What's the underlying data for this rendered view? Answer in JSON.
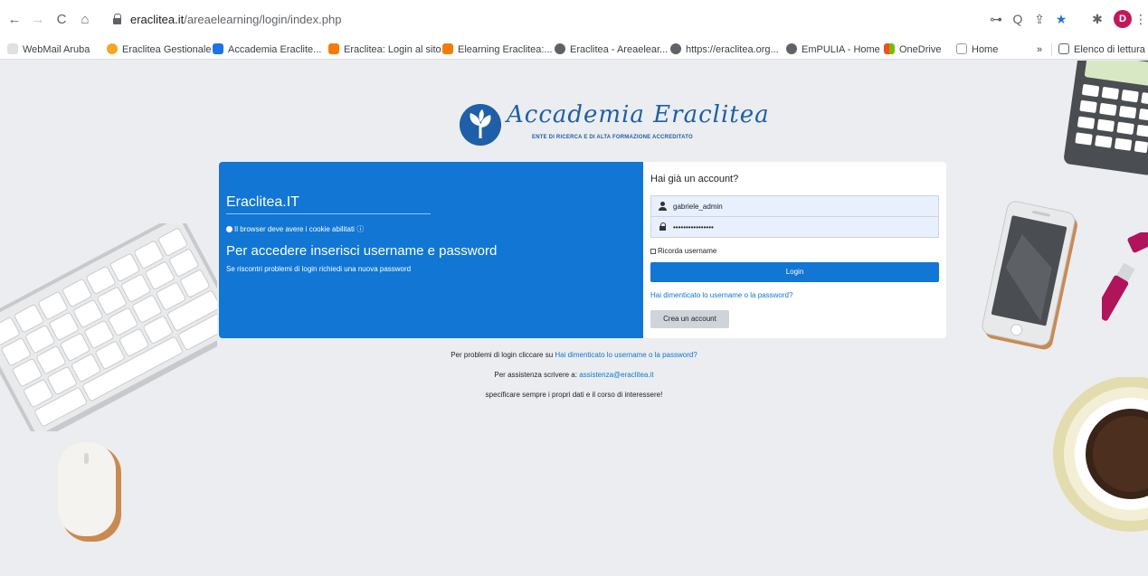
{
  "browser": {
    "url_domain": "eraclitea.it",
    "url_path": "/areaelearning/login/index.php",
    "profile_initial": "D",
    "nav": {
      "back": "←",
      "forward": "→",
      "reload": "C",
      "home": "⌂"
    },
    "toolbar_icons": {
      "key": "⊶",
      "zoom": "Q",
      "share": "⇪",
      "star": "★",
      "extensions": "✱",
      "menu": "⋮"
    }
  },
  "bookmarks": [
    {
      "label": "WebMail Aruba",
      "color": "#e8e8e8"
    },
    {
      "label": "Eraclitea Gestionale",
      "color": "#f6a623"
    },
    {
      "label": "Accademia Eraclite...",
      "color": "#1a73e8"
    },
    {
      "label": "Eraclitea: Login al sito",
      "color": "#f57c00"
    },
    {
      "label": "Elearning Eraclitea:...",
      "color": "#f57c00"
    },
    {
      "label": "Eraclitea - Areaelear...",
      "color": "#5f6368"
    },
    {
      "label": "https://eraclitea.org...",
      "color": "#5f6368"
    },
    {
      "label": "EmPULIA - Home",
      "color": "#5f6368"
    },
    {
      "label": "OneDrive",
      "color": "#f25022"
    },
    {
      "label": "Home",
      "color": "#ffffff"
    }
  ],
  "bookmarks_more": "»",
  "reading_list": "Elenco di lettura",
  "logo": {
    "title": "Accademia Eraclitea",
    "subtitle": "ENTE DI RICERCA E DI ALTA FORMAZIONE ACCREDITATO"
  },
  "left_panel": {
    "site_name": "Eraclitea.IT",
    "cookie_notice": "Il browser deve avere i cookie abilitati",
    "heading": "Per accedere inserisci username e password",
    "help": "Se riscontri problemi di login richiedi una nuova password"
  },
  "login_form": {
    "title": "Hai già un account?",
    "username_value": "gabriele_admin",
    "password_value": "••••••••••••••••",
    "remember_label": "Ricorda username",
    "remember_checked": false,
    "login_button": "Login",
    "forgot_link": "Hai dimenticato lo username o la password?",
    "create_account_button": "Crea un account"
  },
  "notes": {
    "line1_prefix": "Per problemi di login cliccare su",
    "line1_link": "Hai dimenticato lo username o la password?",
    "line2_prefix": "Per assistenza scrivere a:",
    "line2_link": "assistenza@eraclitea.it",
    "line3": "specificare sempre i propri dati e il corso di interessere!"
  },
  "colors": {
    "brand_blue": "#1176d4",
    "logo_blue": "#1e5fa8",
    "page_bg": "#ebedf0"
  }
}
